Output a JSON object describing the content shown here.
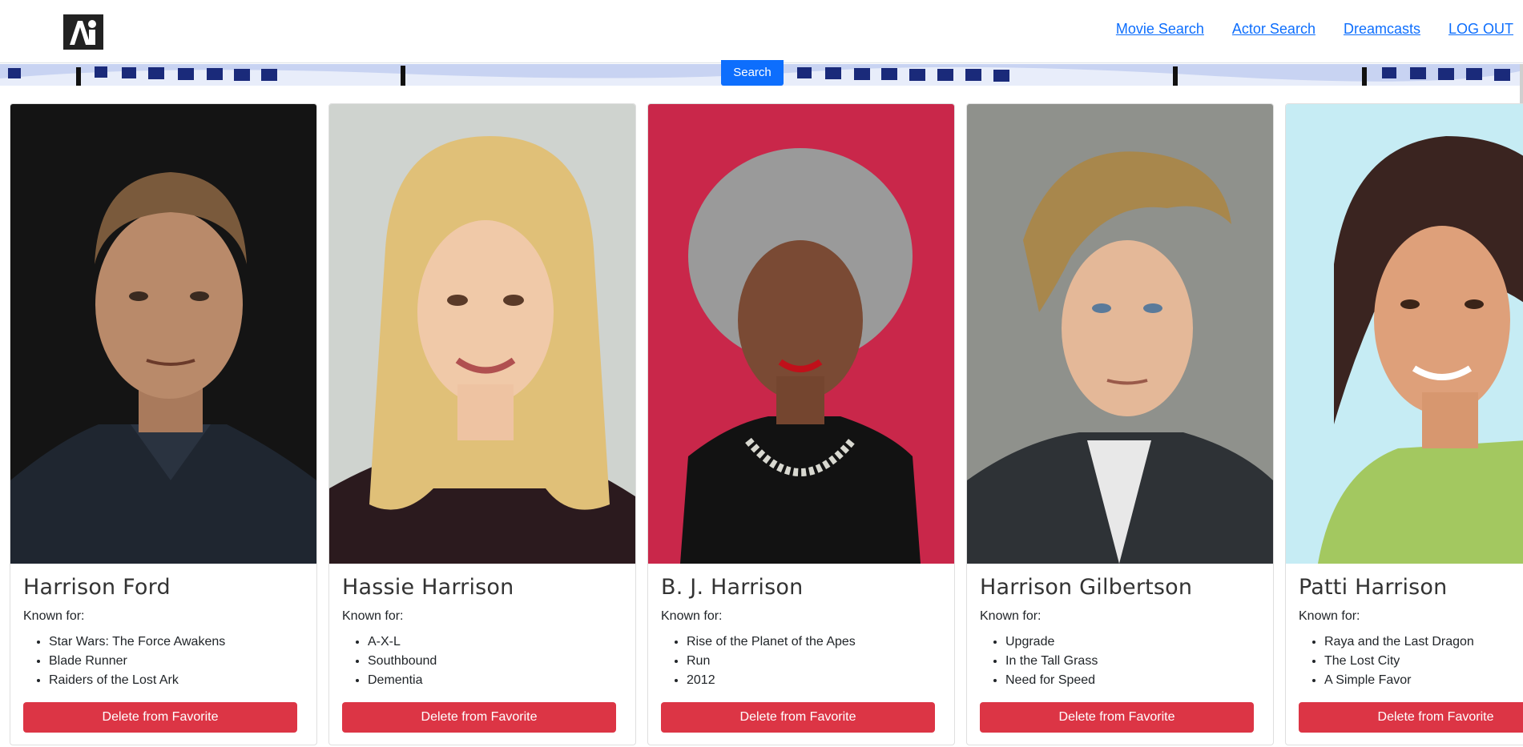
{
  "nav": {
    "logo_icon": "ai-logo-icon",
    "links": [
      {
        "label": "Movie Search"
      },
      {
        "label": "Actor Search"
      },
      {
        "label": "Dreamcasts"
      },
      {
        "label": "LOG OUT"
      }
    ]
  },
  "search": {
    "label": "Search"
  },
  "colors": {
    "link": "#0d6efd",
    "search": "#0d6efd",
    "delete": "#dc3545"
  },
  "cards": [
    {
      "name": "Harrison Ford",
      "known_label": "Known for:",
      "movies": [
        "Star Wars: The Force Awakens",
        "Blade Runner",
        "Raiders of the Lost Ark"
      ],
      "button": "Delete from Favorite"
    },
    {
      "name": "Hassie Harrison",
      "known_label": "Known for:",
      "movies": [
        "A-X-L",
        "Southbound",
        "Dementia"
      ],
      "button": "Delete from Favorite"
    },
    {
      "name": "B. J. Harrison",
      "known_label": "Known for:",
      "movies": [
        "Rise of the Planet of the Apes",
        "Run",
        "2012"
      ],
      "button": "Delete from Favorite"
    },
    {
      "name": "Harrison Gilbertson",
      "known_label": "Known for:",
      "movies": [
        "Upgrade",
        "In the Tall Grass",
        "Need for Speed"
      ],
      "button": "Delete from Favorite"
    },
    {
      "name": "Patti Harrison",
      "known_label": "Known for:",
      "movies": [
        "Raya and the Last Dragon",
        "The Lost City",
        "A Simple Favor"
      ],
      "button": "Delete from Favorite"
    }
  ]
}
